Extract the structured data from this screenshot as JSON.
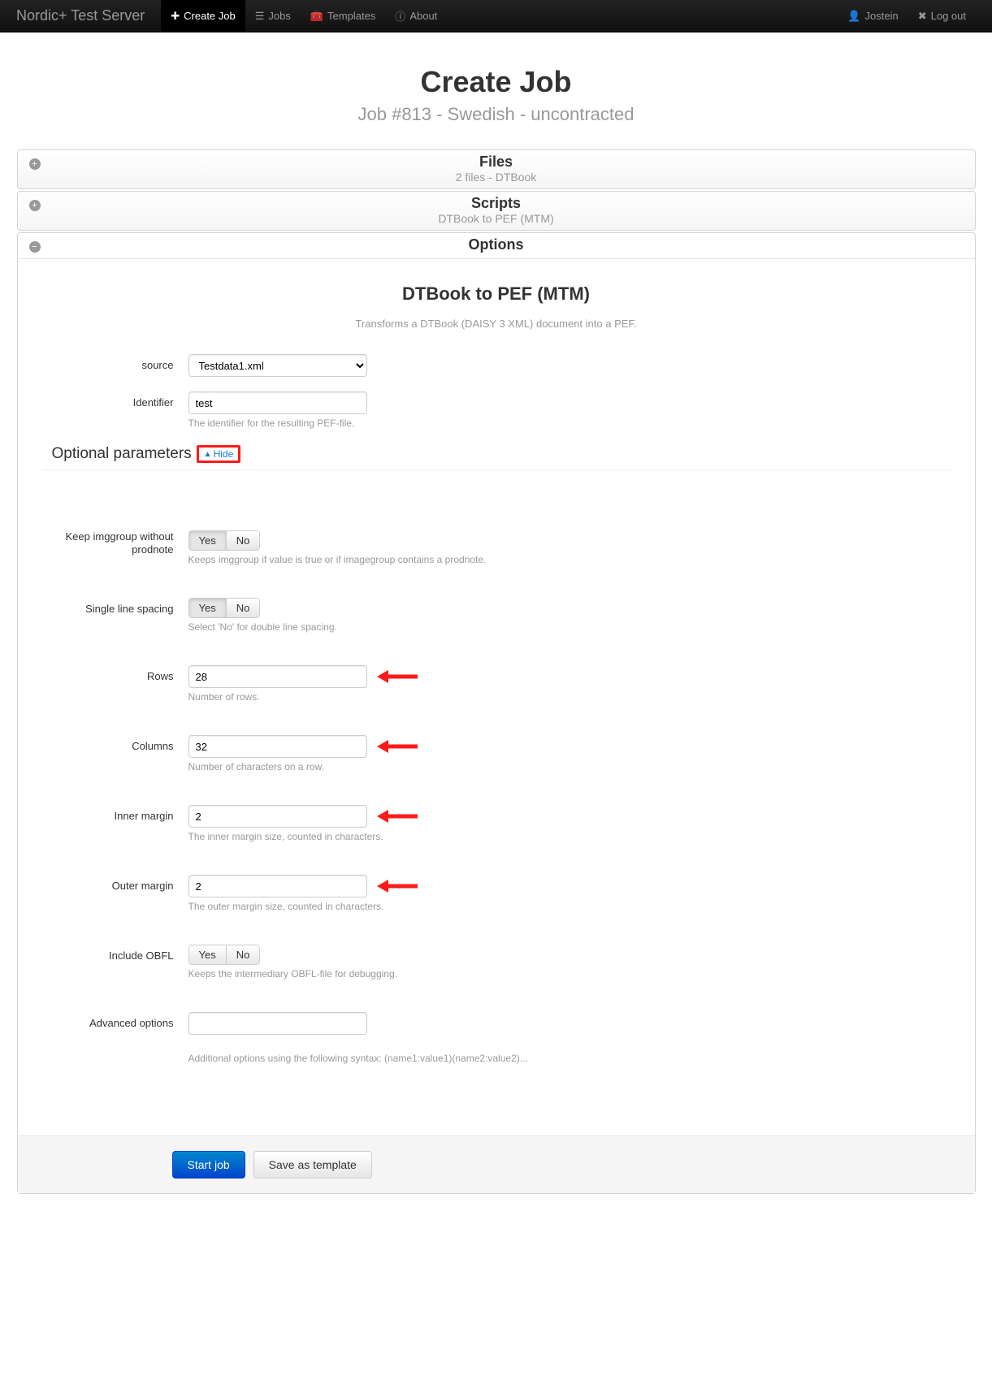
{
  "navbar": {
    "brand": "Nordic+ Test Server",
    "items": [
      {
        "label": "Create Job",
        "icon": "plus-icon",
        "active": true
      },
      {
        "label": "Jobs",
        "icon": "list-icon",
        "active": false
      },
      {
        "label": "Templates",
        "icon": "briefcase-icon",
        "active": false
      },
      {
        "label": "About",
        "icon": "info-icon",
        "active": false
      }
    ],
    "user": "Jostein",
    "logout": "Log out"
  },
  "header": {
    "title": "Create Job",
    "subtitle": "Job #813 - Swedish - uncontracted"
  },
  "panels": {
    "files": {
      "title": "Files",
      "sub": "2 files - DTBook"
    },
    "scripts": {
      "title": "Scripts",
      "sub": "DTBook to PEF (MTM)"
    },
    "options": {
      "title": "Options",
      "section_title": "DTBook to PEF (MTM)",
      "section_desc": "Transforms a DTBook (DAISY 3 XML) document into a PEF."
    }
  },
  "form": {
    "source": {
      "label": "source",
      "value": "Testdata1.xml"
    },
    "identifier": {
      "label": "Identifier",
      "value": "test",
      "help": "The identifier for the resulting PEF-file."
    },
    "optional_label": "Optional parameters",
    "hide_toggle": "Hide",
    "keep_imggroup": {
      "label": "Keep imggroup without prodnote",
      "yes": "Yes",
      "no": "No",
      "active": "Yes",
      "help": "Keeps imggroup if value is true or if imagegroup contains a prodnote."
    },
    "single_line": {
      "label": "Single line spacing",
      "yes": "Yes",
      "no": "No",
      "active": "Yes",
      "help": "Select 'No' for double line spacing."
    },
    "rows": {
      "label": "Rows",
      "value": "28",
      "help": "Number of rows."
    },
    "columns": {
      "label": "Columns",
      "value": "32",
      "help": "Number of characters on a row."
    },
    "inner_margin": {
      "label": "Inner margin",
      "value": "2",
      "help": "The inner margin size, counted in characters."
    },
    "outer_margin": {
      "label": "Outer margin",
      "value": "2",
      "help": "The outer margin size, counted in characters."
    },
    "include_obfl": {
      "label": "Include OBFL",
      "yes": "Yes",
      "no": "No",
      "active": "No",
      "help": "Keeps the intermediary OBFL-file for debugging."
    },
    "advanced": {
      "label": "Advanced options",
      "value": "",
      "help": "Additional options using the following syntax: (name1:value1)(name2:value2)..."
    }
  },
  "actions": {
    "start": "Start job",
    "save_template": "Save as template"
  }
}
